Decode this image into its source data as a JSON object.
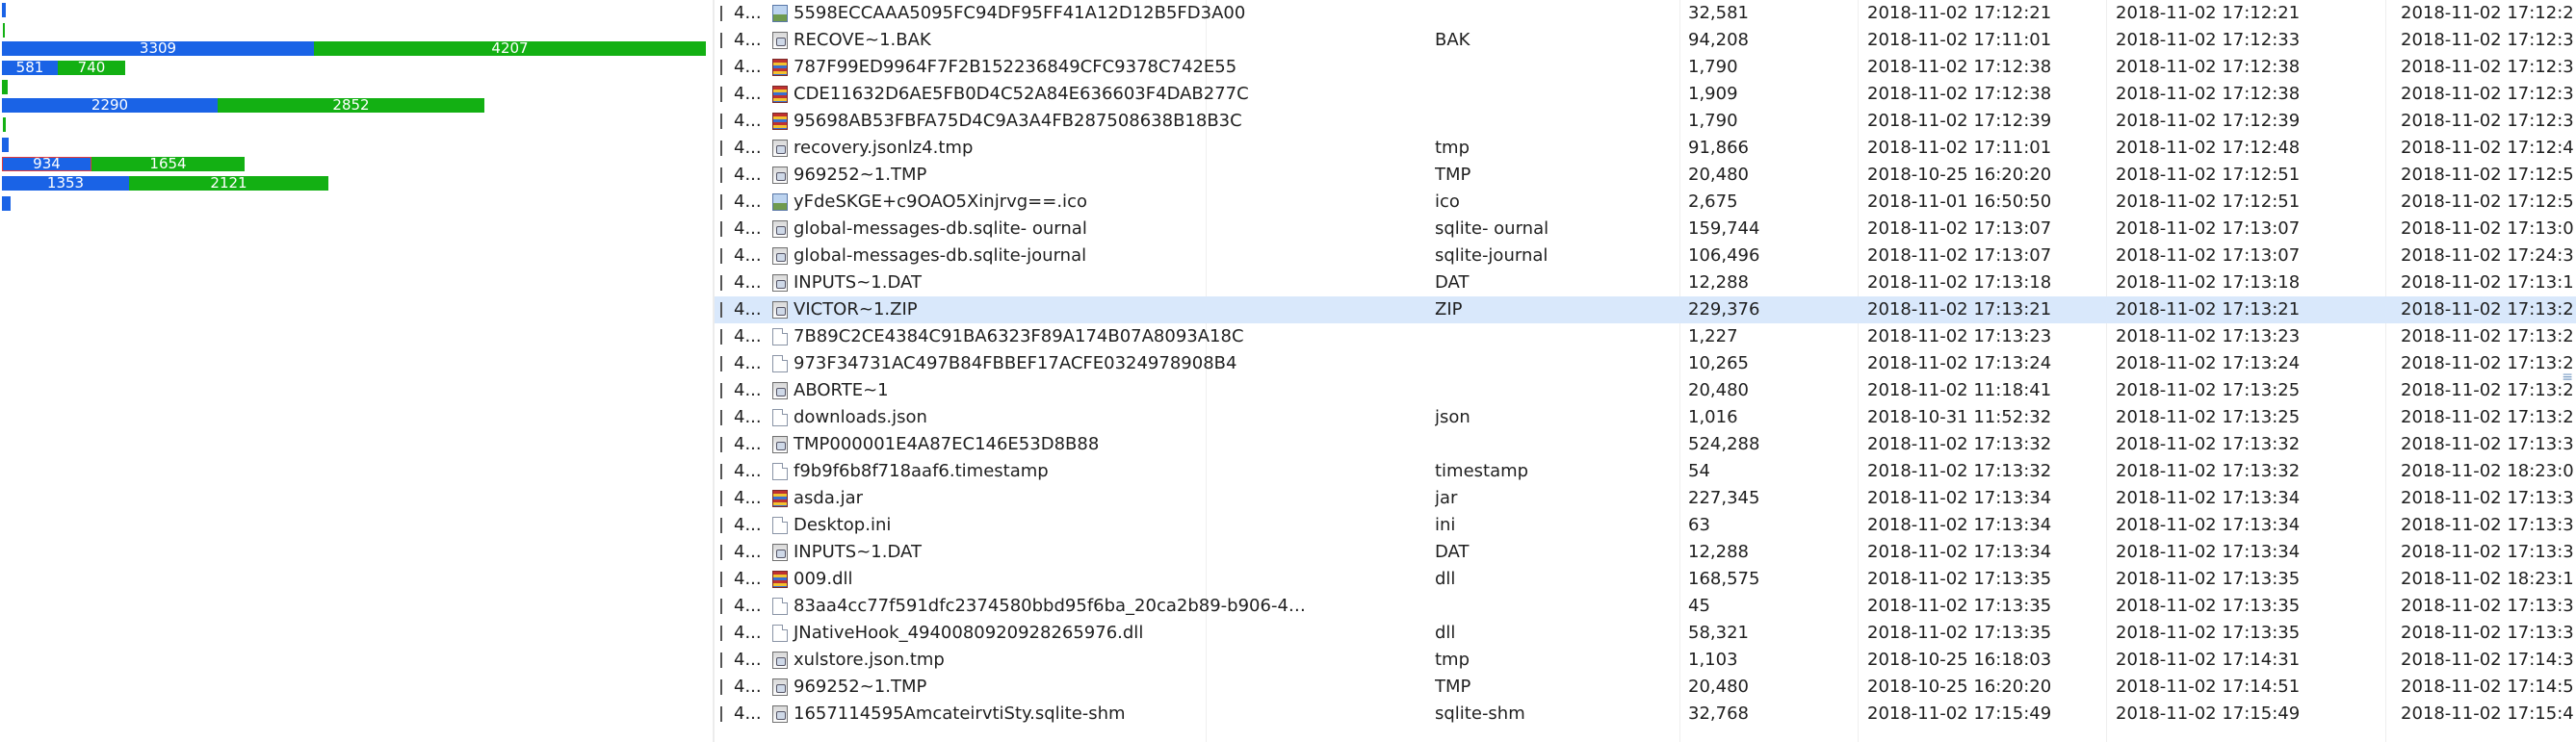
{
  "timeline": {
    "colors": {
      "blue": "#1a63e6",
      "green": "#13b013",
      "selection": "#e23a3a"
    },
    "bars": [
      {
        "segments": [
          {
            "color": "blue",
            "label": ""
          }
        ]
      },
      {
        "segments": [
          {
            "color": "green",
            "label": ""
          }
        ]
      },
      {
        "segments": [
          {
            "color": "blue",
            "label": "3309"
          },
          {
            "color": "green",
            "label": "4207"
          }
        ]
      },
      {
        "segments": [
          {
            "color": "blue",
            "label": "581"
          },
          {
            "color": "green",
            "label": "740"
          }
        ]
      },
      {
        "segments": [
          {
            "color": "green",
            "label": ""
          }
        ]
      },
      {
        "segments": [
          {
            "color": "blue",
            "label": "2290"
          },
          {
            "color": "green",
            "label": "2852"
          }
        ]
      },
      {
        "segments": [
          {
            "color": "green",
            "label": ""
          }
        ]
      },
      {
        "segments": [
          {
            "color": "blue",
            "label": ""
          }
        ]
      },
      {
        "segments": [
          {
            "color": "blue",
            "label": "934",
            "selected": true
          },
          {
            "color": "green",
            "label": "1654"
          }
        ]
      },
      {
        "segments": [
          {
            "color": "blue",
            "label": "1353"
          },
          {
            "color": "green",
            "label": "2121"
          }
        ]
      },
      {
        "segments": [
          {
            "color": "blue",
            "label": ""
          }
        ]
      }
    ]
  },
  "file_table": {
    "rows": [
      {
        "num": "4...",
        "icon": "img-icon",
        "name": "5598ECCAAA5095FC94DF95FF41A12D12B5FD3A00",
        "ext": "",
        "size": "32,581",
        "d1": "2018-11-02 17:12:21",
        "d2": "2018-11-02 17:12:21",
        "d3": "2018-11-02 17:12:2"
      },
      {
        "num": "4...",
        "icon": "app-icon",
        "name": "RECOVE~1.BAK",
        "ext": "BAK",
        "size": "94,208",
        "d1": "2018-11-02 17:11:01",
        "d2": "2018-11-02 17:12:33",
        "d3": "2018-11-02 17:12:3"
      },
      {
        "num": "4...",
        "icon": "zip-icon",
        "name": "787F99ED9964F7F2B152236849CFC9378C742E55",
        "ext": "",
        "size": "1,790",
        "d1": "2018-11-02 17:12:38",
        "d2": "2018-11-02 17:12:38",
        "d3": "2018-11-02 17:12:3"
      },
      {
        "num": "4...",
        "icon": "zip-icon",
        "name": "CDE11632D6AE5FB0D4C52A84E636603F4DAB277C",
        "ext": "",
        "size": "1,909",
        "d1": "2018-11-02 17:12:38",
        "d2": "2018-11-02 17:12:38",
        "d3": "2018-11-02 17:12:3"
      },
      {
        "num": "4...",
        "icon": "zip-icon",
        "name": "95698AB53FBFA75D4C9A3A4FB287508638B18B3C",
        "ext": "",
        "size": "1,790",
        "d1": "2018-11-02 17:12:39",
        "d2": "2018-11-02 17:12:39",
        "d3": "2018-11-02 17:12:3"
      },
      {
        "num": "4...",
        "icon": "app-icon",
        "name": "recovery.jsonlz4.tmp",
        "ext": "tmp",
        "size": "91,866",
        "d1": "2018-11-02 17:11:01",
        "d2": "2018-11-02 17:12:48",
        "d3": "2018-11-02 17:12:4"
      },
      {
        "num": "4...",
        "icon": "app-icon",
        "name": "969252~1.TMP",
        "ext": "TMP",
        "size": "20,480",
        "d1": "2018-10-25 16:20:20",
        "d2": "2018-11-02 17:12:51",
        "d3": "2018-11-02 17:12:5"
      },
      {
        "num": "4...",
        "icon": "img-icon",
        "name": "yFdeSKGE+c9OAO5Xinjrvg==.ico",
        "ext": "ico",
        "size": "2,675",
        "d1": "2018-11-01 16:50:50",
        "d2": "2018-11-02 17:12:51",
        "d3": "2018-11-02 17:12:5"
      },
      {
        "num": "4...",
        "icon": "app-icon",
        "name": "global-messages-db.sqlite- ournal",
        "ext": "sqlite- ournal",
        "size": "159,744",
        "d1": "2018-11-02 17:13:07",
        "d2": "2018-11-02 17:13:07",
        "d3": "2018-11-02 17:13:0"
      },
      {
        "num": "4...",
        "icon": "app-icon",
        "name": "global-messages-db.sqlite-journal",
        "ext": "sqlite-journal",
        "size": "106,496",
        "d1": "2018-11-02 17:13:07",
        "d2": "2018-11-02 17:13:07",
        "d3": "2018-11-02 17:24:3"
      },
      {
        "num": "4...",
        "icon": "app-icon",
        "name": "INPUTS~1.DAT",
        "ext": "DAT",
        "size": "12,288",
        "d1": "2018-11-02 17:13:18",
        "d2": "2018-11-02 17:13:18",
        "d3": "2018-11-02 17:13:1"
      },
      {
        "num": "4...",
        "icon": "app-icon",
        "name": "VICTOR~1.ZIP",
        "ext": "ZIP",
        "size": "229,376",
        "d1": "2018-11-02 17:13:21",
        "d2": "2018-11-02 17:13:21",
        "d3": "2018-11-02 17:13:2",
        "selected": true
      },
      {
        "num": "4...",
        "icon": "doc-icon",
        "name": "7B89C2CE4384C91BA6323F89A174B07A8093A18C",
        "ext": "",
        "size": "1,227",
        "d1": "2018-11-02 17:13:23",
        "d2": "2018-11-02 17:13:23",
        "d3": "2018-11-02 17:13:2"
      },
      {
        "num": "4...",
        "icon": "doc-icon",
        "name": "973F34731AC497B84FBBEF17ACFE0324978908B4",
        "ext": "",
        "size": "10,265",
        "d1": "2018-11-02 17:13:24",
        "d2": "2018-11-02 17:13:24",
        "d3": "2018-11-02 17:13:2"
      },
      {
        "num": "4...",
        "icon": "app-icon",
        "name": "ABORTE~1",
        "ext": "",
        "size": "20,480",
        "d1": "2018-11-02 11:18:41",
        "d2": "2018-11-02 17:13:25",
        "d3": "2018-11-02 17:13:2"
      },
      {
        "num": "4...",
        "icon": "doc-icon",
        "name": "downloads.json",
        "ext": "json",
        "size": "1,016",
        "d1": "2018-10-31 11:52:32",
        "d2": "2018-11-02 17:13:25",
        "d3": "2018-11-02 17:13:2"
      },
      {
        "num": "4...",
        "icon": "app-icon",
        "name": "TMP000001E4A87EC146E53D8B88",
        "ext": "",
        "size": "524,288",
        "d1": "2018-11-02 17:13:32",
        "d2": "2018-11-02 17:13:32",
        "d3": "2018-11-02 17:13:3"
      },
      {
        "num": "4...",
        "icon": "doc-icon",
        "name": "f9b9f6b8f718aaf6.timestamp",
        "ext": "timestamp",
        "size": "54",
        "d1": "2018-11-02 17:13:32",
        "d2": "2018-11-02 17:13:32",
        "d3": "2018-11-02 18:23:0"
      },
      {
        "num": "4...",
        "icon": "zip-icon",
        "name": "asda.jar",
        "ext": "jar",
        "size": "227,345",
        "d1": "2018-11-02 17:13:34",
        "d2": "2018-11-02 17:13:34",
        "d3": "2018-11-02 17:13:3"
      },
      {
        "num": "4...",
        "icon": "doc-icon",
        "name": "Desktop.ini",
        "ext": "ini",
        "size": "63",
        "d1": "2018-11-02 17:13:34",
        "d2": "2018-11-02 17:13:34",
        "d3": "2018-11-02 17:13:3"
      },
      {
        "num": "4...",
        "icon": "app-icon",
        "name": "INPUTS~1.DAT",
        "ext": "DAT",
        "size": "12,288",
        "d1": "2018-11-02 17:13:34",
        "d2": "2018-11-02 17:13:34",
        "d3": "2018-11-02 17:13:3"
      },
      {
        "num": "4...",
        "icon": "zip-icon",
        "name": "009.dll",
        "ext": "dll",
        "size": "168,575",
        "d1": "2018-11-02 17:13:35",
        "d2": "2018-11-02 17:13:35",
        "d3": "2018-11-02 18:23:1"
      },
      {
        "num": "4...",
        "icon": "doc-icon",
        "name": "83aa4cc77f591dfc2374580bbd95f6ba_20ca2b89-b906-4…",
        "ext": "",
        "size": "45",
        "d1": "2018-11-02 17:13:35",
        "d2": "2018-11-02 17:13:35",
        "d3": "2018-11-02 17:13:3"
      },
      {
        "num": "4...",
        "icon": "doc-icon",
        "name": "JNativeHook_4940080920928265976.dll",
        "ext": "dll",
        "size": "58,321",
        "d1": "2018-11-02 17:13:35",
        "d2": "2018-11-02 17:13:35",
        "d3": "2018-11-02 17:13:3"
      },
      {
        "num": "4...",
        "icon": "app-icon",
        "name": "xulstore.json.tmp",
        "ext": "tmp",
        "size": "1,103",
        "d1": "2018-10-25 16:18:03",
        "d2": "2018-11-02 17:14:31",
        "d3": "2018-11-02 17:14:3"
      },
      {
        "num": "4...",
        "icon": "app-icon",
        "name": "969252~1.TMP",
        "ext": "TMP",
        "size": "20,480",
        "d1": "2018-10-25 16:20:20",
        "d2": "2018-11-02 17:14:51",
        "d3": "2018-11-02 17:14:5"
      },
      {
        "num": "4...",
        "icon": "app-icon",
        "name": "1657114595AmcateirvtiSty.sqlite-shm",
        "ext": "sqlite-shm",
        "size": "32,768",
        "d1": "2018-11-02 17:15:49",
        "d2": "2018-11-02 17:15:49",
        "d3": "2018-11-02 17:15:4"
      }
    ]
  }
}
